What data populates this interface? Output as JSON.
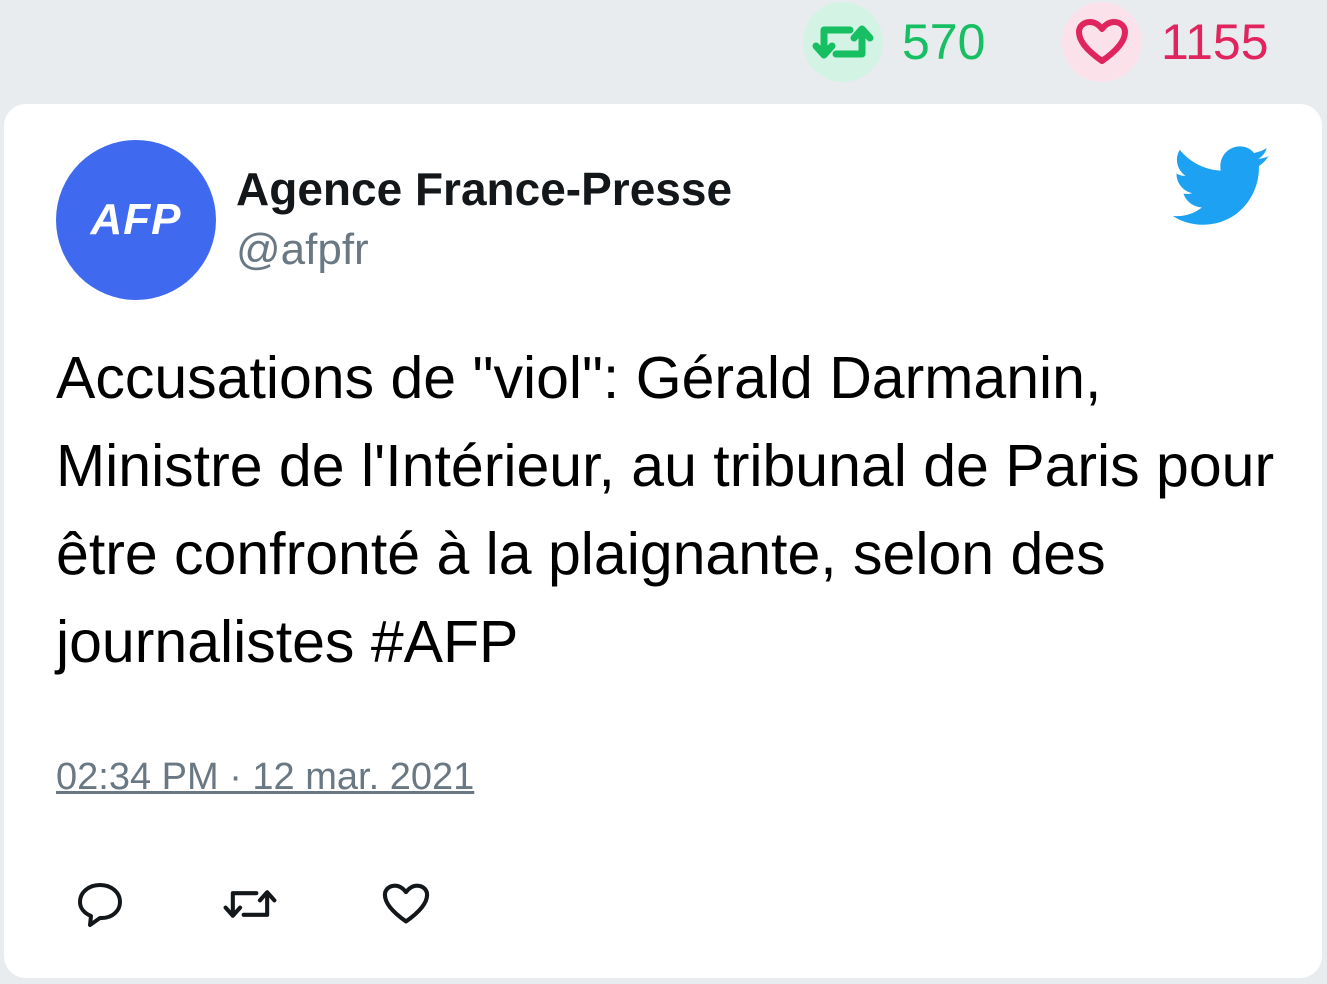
{
  "stats": {
    "retweet_count": "570",
    "like_count": "1155",
    "retweet_icon": "retweet-icon",
    "like_icon": "heart-icon",
    "retweet_color": "#17bf63",
    "like_color": "#e0245e"
  },
  "tweet": {
    "avatar_text": "AFP",
    "avatar_color": "#3f69ef",
    "author_name": "Agence France-Presse",
    "author_handle": "@afpfr",
    "text": "Accusations de \"viol\": Gérald Darmanin, Ministre de l'Intérieur, au tribunal de Paris pour être confronté à la plaignante, selon des journalistes #AFP",
    "timestamp": "02:34 PM · 12 mar. 2021",
    "brand_icon": "twitter-bird-icon",
    "brand_color": "#1da1f2"
  },
  "actions": [
    {
      "icon": "reply-icon"
    },
    {
      "icon": "retweet-icon"
    },
    {
      "icon": "heart-icon"
    }
  ]
}
